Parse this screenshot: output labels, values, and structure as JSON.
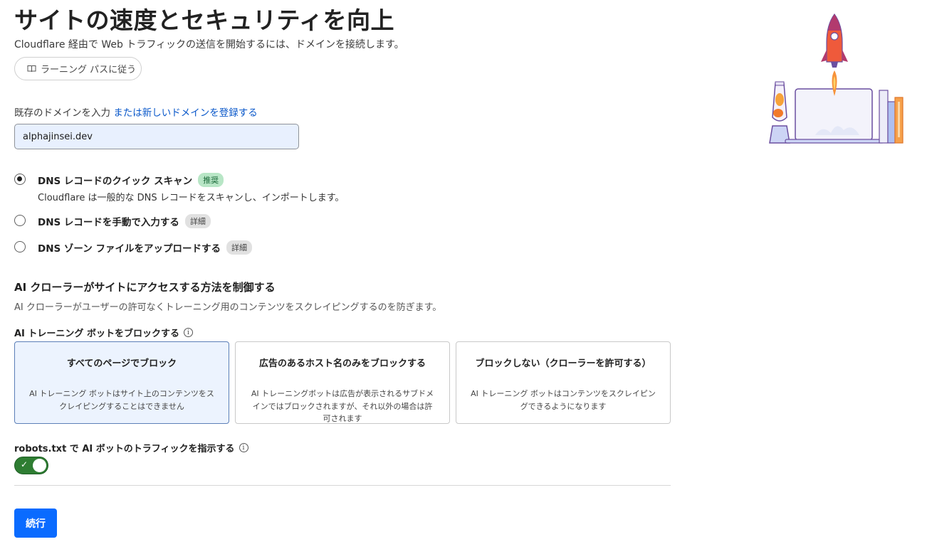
{
  "header": {
    "title": "サイトの速度とセキュリティを向上",
    "subtitle": "Cloudflare 経由で Web トラフィックの送信を開始するには、ドメインを接続します。",
    "learning_path_label": "ラーニング パスに従う"
  },
  "domain": {
    "label": "既存のドメインを入力",
    "register_link": "または新しいドメインを登録する",
    "value": "alphajinsei.dev"
  },
  "dns_options": [
    {
      "title": "DNS レコードのクイック スキャン",
      "badge": "推奨",
      "description": "Cloudflare は一般的な DNS レコードをスキャンし、インポートします。",
      "checked": true
    },
    {
      "title": "DNS レコードを手動で入力する",
      "badge": "詳細",
      "checked": false
    },
    {
      "title": "DNS ゾーン ファイルをアップロードする",
      "badge": "詳細",
      "checked": false
    }
  ],
  "ai_section": {
    "title": "AI クローラーがサイトにアクセスする方法を制御する",
    "description": "AI クローラーがユーザーの許可なくトレーニング用のコンテンツをスクレイピングするのを防ぎます。",
    "block_label": "AI トレーニング ボットをブロックする",
    "cards": [
      {
        "title": "すべてのページでブロック",
        "description": "AI トレーニング ボットはサイト上のコンテンツをスクレイピングすることはできません",
        "selected": true
      },
      {
        "title": "広告のあるホスト名のみをブロックする",
        "description": "AI トレーニングボットは広告が表示されるサブドメインではブロックされますが、それ以外の場合は許可されます",
        "selected": false
      },
      {
        "title": "ブロックしない（クローラーを許可する）",
        "description": "AI トレーニング ボットはコンテンツをスクレイピングできるようになります",
        "selected": false
      }
    ],
    "robots_label": "robots.txt で AI ボットのトラフィックを指示する",
    "robots_enabled": true
  },
  "footer": {
    "continue_label": "続行"
  },
  "colors": {
    "accent": "#0a6bff",
    "link": "#0a58ca",
    "toggle_on": "#2e7d32",
    "recommended_badge": "#b8e6c6"
  },
  "icons": {
    "learning": "book-icon",
    "info": "info-icon",
    "toggle_check": "check-icon"
  }
}
